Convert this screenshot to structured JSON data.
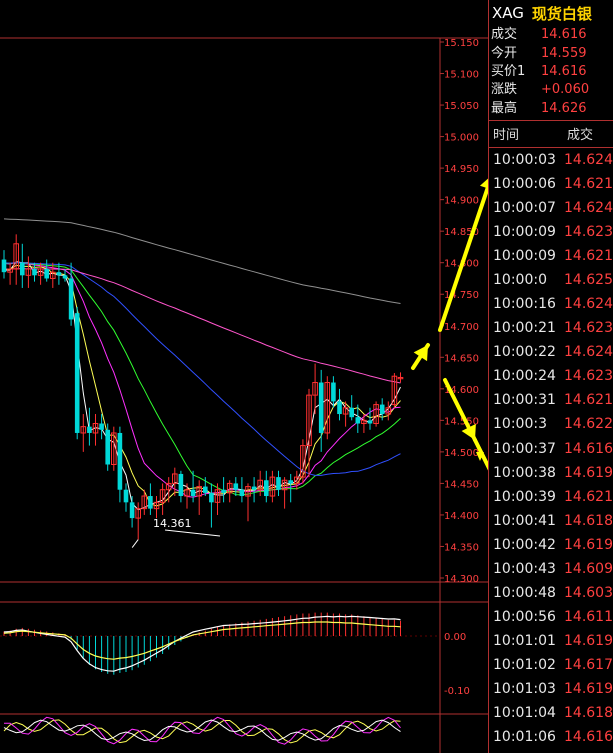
{
  "quote_panel": {
    "symbol": "XAG",
    "name": "现货白银",
    "fields": [
      {
        "label": "成交",
        "value": "14.616"
      },
      {
        "label": "今开",
        "value": "14.559"
      },
      {
        "label": "买价1",
        "value": "14.616"
      },
      {
        "label": "涨跌",
        "value": "+0.060"
      },
      {
        "label": "最高",
        "value": "14.626"
      }
    ],
    "ticks_header": {
      "time": "时间",
      "price": "成交"
    },
    "ticks": [
      {
        "time": "10:00:03",
        "price": "14.624"
      },
      {
        "time": "10:00:06",
        "price": "14.621"
      },
      {
        "time": "10:00:07",
        "price": "14.624"
      },
      {
        "time": "10:00:09",
        "price": "14.623"
      },
      {
        "time": "10:00:09",
        "price": "14.621"
      },
      {
        "time": "10:00:0",
        "price": "14.625"
      },
      {
        "time": "10:00:16",
        "price": "14.624"
      },
      {
        "time": "10:00:21",
        "price": "14.623"
      },
      {
        "time": "10:00:22",
        "price": "14.624"
      },
      {
        "time": "10:00:24",
        "price": "14.623"
      },
      {
        "time": "10:00:31",
        "price": "14.621"
      },
      {
        "time": "10:00:3",
        "price": "14.622"
      },
      {
        "time": "10:00:37",
        "price": "14.616"
      },
      {
        "time": "10:00:38",
        "price": "14.619"
      },
      {
        "time": "10:00:39",
        "price": "14.621"
      },
      {
        "time": "10:00:41",
        "price": "14.618"
      },
      {
        "time": "10:00:42",
        "price": "14.619"
      },
      {
        "time": "10:00:43",
        "price": "14.609"
      },
      {
        "time": "10:00:48",
        "price": "14.603"
      },
      {
        "time": "10:00:56",
        "price": "14.611"
      },
      {
        "time": "10:01:01",
        "price": "14.619"
      },
      {
        "time": "10:01:02",
        "price": "14.617"
      },
      {
        "time": "10:01:03",
        "price": "14.619"
      },
      {
        "time": "10:01:04",
        "price": "14.618"
      },
      {
        "time": "10:01:06",
        "price": "14.616"
      }
    ]
  },
  "chart_data": [
    {
      "type": "candlestick",
      "price_axis": {
        "ylim": [
          14.3,
          15.15
        ],
        "ticks": [
          "15.150",
          "15.100",
          "15.050",
          "15.000",
          "14.950",
          "14.900",
          "14.850",
          "14.800",
          "14.750",
          "14.700",
          "14.650",
          "14.600",
          "14.550",
          "14.500",
          "14.450",
          "14.400",
          "14.350",
          "14.300"
        ]
      },
      "annotation_low": "14.361",
      "colors": {
        "up": "#ff3030",
        "down": "#00d8d8",
        "ma_white": "#ffffff",
        "ma_yellow": "#ffff55",
        "ma_magenta": "#ff30ff",
        "ma_green": "#30ff30",
        "ma_blue": "#3050ff",
        "ma_pink": "#ff55cc",
        "ma_gray": "#909090"
      },
      "candles": [
        {
          "o": 14.805,
          "h": 14.82,
          "l": 14.775,
          "c": 14.785
        },
        {
          "o": 14.785,
          "h": 14.8,
          "l": 14.765,
          "c": 14.79
        },
        {
          "o": 14.79,
          "h": 14.845,
          "l": 14.765,
          "c": 14.83
        },
        {
          "o": 14.8,
          "h": 14.83,
          "l": 14.76,
          "c": 14.78
        },
        {
          "o": 14.78,
          "h": 14.81,
          "l": 14.76,
          "c": 14.79
        },
        {
          "o": 14.79,
          "h": 14.8,
          "l": 14.77,
          "c": 14.78
        },
        {
          "o": 14.78,
          "h": 14.8,
          "l": 14.765,
          "c": 14.79
        },
        {
          "o": 14.79,
          "h": 14.805,
          "l": 14.77,
          "c": 14.775
        },
        {
          "o": 14.775,
          "h": 14.8,
          "l": 14.76,
          "c": 14.785
        },
        {
          "o": 14.785,
          "h": 14.8,
          "l": 14.765,
          "c": 14.78
        },
        {
          "o": 14.78,
          "h": 14.79,
          "l": 14.77,
          "c": 14.775
        },
        {
          "o": 14.775,
          "h": 14.8,
          "l": 14.7,
          "c": 14.71
        },
        {
          "o": 14.72,
          "h": 14.73,
          "l": 14.52,
          "c": 14.53
        },
        {
          "o": 14.53,
          "h": 14.56,
          "l": 14.5,
          "c": 14.54
        },
        {
          "o": 14.54,
          "h": 14.57,
          "l": 14.51,
          "c": 14.53
        },
        {
          "o": 14.53,
          "h": 14.56,
          "l": 14.51,
          "c": 14.545
        },
        {
          "o": 14.545,
          "h": 14.56,
          "l": 14.52,
          "c": 14.535
        },
        {
          "o": 14.535,
          "h": 14.545,
          "l": 14.47,
          "c": 14.48
        },
        {
          "o": 14.48,
          "h": 14.54,
          "l": 14.47,
          "c": 14.53
        },
        {
          "o": 14.53,
          "h": 14.54,
          "l": 14.42,
          "c": 14.44
        },
        {
          "o": 14.44,
          "h": 14.45,
          "l": 14.405,
          "c": 14.42
        },
        {
          "o": 14.42,
          "h": 14.43,
          "l": 14.38,
          "c": 14.395
        },
        {
          "o": 14.395,
          "h": 14.42,
          "l": 14.361,
          "c": 14.41
        },
        {
          "o": 14.41,
          "h": 14.44,
          "l": 14.4,
          "c": 14.43
        },
        {
          "o": 14.43,
          "h": 14.45,
          "l": 14.4,
          "c": 14.41
        },
        {
          "o": 14.41,
          "h": 14.43,
          "l": 14.395,
          "c": 14.42
        },
        {
          "o": 14.42,
          "h": 14.45,
          "l": 14.4,
          "c": 14.44
        },
        {
          "o": 14.44,
          "h": 14.46,
          "l": 14.42,
          "c": 14.45
        },
        {
          "o": 14.45,
          "h": 14.475,
          "l": 14.43,
          "c": 14.465
        },
        {
          "o": 14.465,
          "h": 14.47,
          "l": 14.42,
          "c": 14.43
        },
        {
          "o": 14.43,
          "h": 14.45,
          "l": 14.41,
          "c": 14.44
        },
        {
          "o": 14.44,
          "h": 14.47,
          "l": 14.42,
          "c": 14.43
        },
        {
          "o": 14.43,
          "h": 14.455,
          "l": 14.4,
          "c": 14.445
        },
        {
          "o": 14.445,
          "h": 14.46,
          "l": 14.43,
          "c": 14.435
        },
        {
          "o": 14.435,
          "h": 14.45,
          "l": 14.38,
          "c": 14.42
        },
        {
          "o": 14.42,
          "h": 14.45,
          "l": 14.4,
          "c": 14.44
        },
        {
          "o": 14.44,
          "h": 14.46,
          "l": 14.42,
          "c": 14.435
        },
        {
          "o": 14.435,
          "h": 14.455,
          "l": 14.42,
          "c": 14.45
        },
        {
          "o": 14.45,
          "h": 14.46,
          "l": 14.43,
          "c": 14.44
        },
        {
          "o": 14.44,
          "h": 14.46,
          "l": 14.42,
          "c": 14.43
        },
        {
          "o": 14.43,
          "h": 14.45,
          "l": 14.39,
          "c": 14.445
        },
        {
          "o": 14.445,
          "h": 14.46,
          "l": 14.42,
          "c": 14.44
        },
        {
          "o": 14.44,
          "h": 14.47,
          "l": 14.43,
          "c": 14.455
        },
        {
          "o": 14.455,
          "h": 14.47,
          "l": 14.42,
          "c": 14.43
        },
        {
          "o": 14.43,
          "h": 14.47,
          "l": 14.42,
          "c": 14.46
        },
        {
          "o": 14.46,
          "h": 14.47,
          "l": 14.43,
          "c": 14.44
        },
        {
          "o": 14.44,
          "h": 14.46,
          "l": 14.41,
          "c": 14.455
        },
        {
          "o": 14.455,
          "h": 14.465,
          "l": 14.42,
          "c": 14.45
        },
        {
          "o": 14.45,
          "h": 14.47,
          "l": 14.44,
          "c": 14.46
        },
        {
          "o": 14.46,
          "h": 14.52,
          "l": 14.45,
          "c": 14.51
        },
        {
          "o": 14.51,
          "h": 14.6,
          "l": 14.46,
          "c": 14.59
        },
        {
          "o": 14.59,
          "h": 14.64,
          "l": 14.56,
          "c": 14.61
        },
        {
          "o": 14.61,
          "h": 14.63,
          "l": 14.5,
          "c": 14.53
        },
        {
          "o": 14.53,
          "h": 14.62,
          "l": 14.52,
          "c": 14.61
        },
        {
          "o": 14.61,
          "h": 14.62,
          "l": 14.57,
          "c": 14.58
        },
        {
          "o": 14.58,
          "h": 14.6,
          "l": 14.55,
          "c": 14.56
        },
        {
          "o": 14.56,
          "h": 14.58,
          "l": 14.54,
          "c": 14.57
        },
        {
          "o": 14.57,
          "h": 14.59,
          "l": 14.55,
          "c": 14.555
        },
        {
          "o": 14.555,
          "h": 14.575,
          "l": 14.53,
          "c": 14.545
        },
        {
          "o": 14.545,
          "h": 14.56,
          "l": 14.53,
          "c": 14.55
        },
        {
          "o": 14.55,
          "h": 14.57,
          "l": 14.535,
          "c": 14.545
        },
        {
          "o": 14.545,
          "h": 14.58,
          "l": 14.54,
          "c": 14.575
        },
        {
          "o": 14.575,
          "h": 14.585,
          "l": 14.55,
          "c": 14.56
        },
        {
          "o": 14.56,
          "h": 14.58,
          "l": 14.55,
          "c": 14.57
        },
        {
          "o": 14.575,
          "h": 14.625,
          "l": 14.57,
          "c": 14.62
        },
        {
          "o": 14.616,
          "h": 14.626,
          "l": 14.61,
          "c": 14.618
        }
      ]
    },
    {
      "type": "macd",
      "axis_ticks": [
        "0.00",
        "-0.10"
      ],
      "histogram": [
        0.005,
        0.006,
        0.008,
        0.009,
        0.008,
        0.007,
        0.006,
        0.005,
        0.004,
        0.003,
        0.002,
        -0.004,
        -0.015,
        -0.025,
        -0.032,
        -0.037,
        -0.04,
        -0.042,
        -0.043,
        -0.041,
        -0.04,
        -0.038,
        -0.035,
        -0.032,
        -0.028,
        -0.024,
        -0.02,
        -0.015,
        -0.01,
        -0.006,
        -0.002,
        0.002,
        0.004,
        0.006,
        0.008,
        0.01,
        0.012,
        0.013,
        0.014,
        0.015,
        0.016,
        0.017,
        0.018,
        0.019,
        0.02,
        0.021,
        0.022,
        0.023,
        0.024,
        0.025,
        0.025,
        0.026,
        0.026,
        0.026,
        0.025,
        0.025,
        0.024,
        0.024,
        0.023,
        0.022,
        0.021,
        0.02,
        0.019,
        0.018,
        0.018,
        0.017
      ]
    },
    {
      "type": "line",
      "name": "indicator-lower"
    }
  ]
}
